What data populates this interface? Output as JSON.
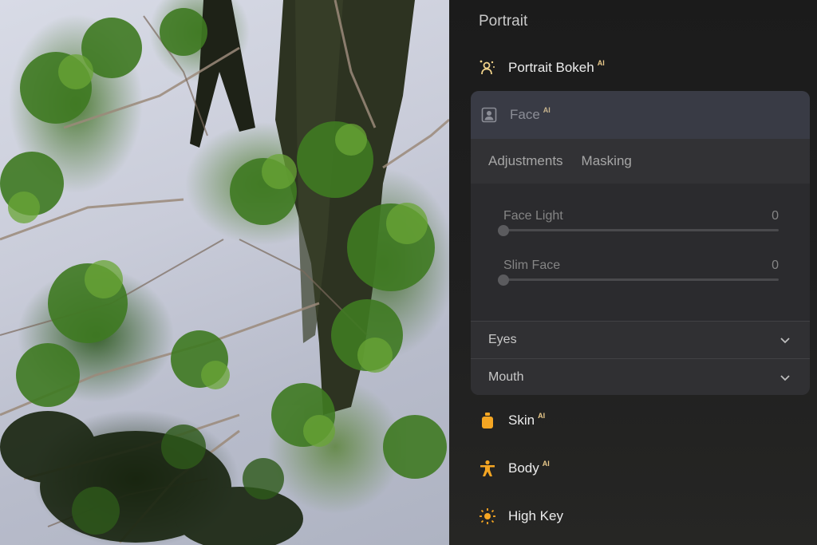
{
  "panel": {
    "title": "Portrait",
    "ai_badge": "AI",
    "tools": [
      {
        "label": "Portrait Bokeh",
        "icon": "portrait-bokeh-icon",
        "ai": true
      },
      {
        "label": "Face",
        "icon": "face-icon",
        "ai": true,
        "expanded": true
      },
      {
        "label": "Skin",
        "icon": "skin-bottle-icon",
        "ai": true
      },
      {
        "label": "Body",
        "icon": "body-figure-icon",
        "ai": true
      },
      {
        "label": "High Key",
        "icon": "high-key-sun-icon",
        "ai": false
      }
    ],
    "face": {
      "tabs": [
        "Adjustments",
        "Masking"
      ],
      "sliders": [
        {
          "label": "Face Light",
          "value": "0",
          "level": 0
        },
        {
          "label": "Slim Face",
          "value": "0",
          "level": 0
        }
      ],
      "sections": [
        {
          "label": "Eyes",
          "icon": "chevron-down-icon"
        },
        {
          "label": "Mouth",
          "icon": "chevron-down-icon"
        }
      ]
    }
  },
  "colors": {
    "accent_orange": "#f5a623",
    "accent_yellow": "#f2d48b",
    "panel_bg": "#1b1b1b",
    "card_bg": "#2c2c2f"
  }
}
